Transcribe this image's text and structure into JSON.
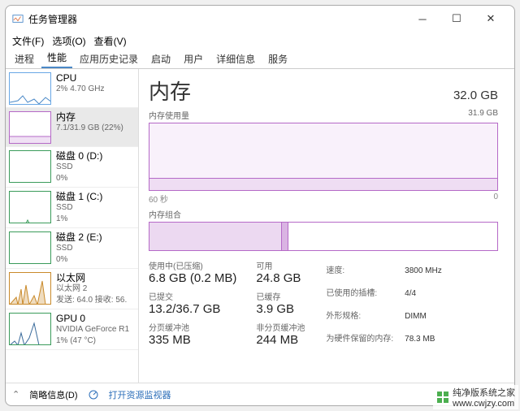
{
  "title": "任务管理器",
  "menu": {
    "file": "文件(F)",
    "options": "选项(O)",
    "view": "查看(V)"
  },
  "tabs": {
    "processes": "进程",
    "performance": "性能",
    "history": "应用历史记录",
    "startup": "启动",
    "users": "用户",
    "details": "详细信息",
    "services": "服务"
  },
  "side": {
    "cpu": {
      "title": "CPU",
      "sub": "2%  4.70 GHz"
    },
    "mem": {
      "title": "内存",
      "sub": "7.1/31.9 GB (22%)"
    },
    "disk0": {
      "title": "磁盘 0 (D:)",
      "type": "SSD",
      "pct": "0%"
    },
    "disk1": {
      "title": "磁盘 1 (C:)",
      "type": "SSD",
      "pct": "1%"
    },
    "disk2": {
      "title": "磁盘 2 (E:)",
      "type": "SSD",
      "pct": "0%"
    },
    "eth": {
      "title": "以太网",
      "name": "以太网 2",
      "sub": "发送: 64.0  接收: 56."
    },
    "gpu": {
      "title": "GPU 0",
      "name": "NVIDIA GeForce R1",
      "sub": "1% (47 °C)"
    }
  },
  "main": {
    "title": "内存",
    "total": "32.0 GB",
    "usage_label": "内存使用量",
    "usage_max": "31.9 GB",
    "axis_left": "60 秒",
    "axis_right": "0",
    "comp_label": "内存组合",
    "stats": {
      "inuse_label": "使用中(已压缩)",
      "inuse": "6.8 GB (0.2 MB)",
      "avail_label": "可用",
      "avail": "24.8 GB",
      "commit_label": "已提交",
      "commit": "13.2/36.7 GB",
      "cached_label": "已缓存",
      "cached": "3.9 GB",
      "paged_label": "分页缓冲池",
      "paged": "335 MB",
      "nonpaged_label": "非分页缓冲池",
      "nonpaged": "244 MB"
    },
    "right": {
      "speed_l": "速度:",
      "speed": "3800 MHz",
      "slots_l": "已使用的插槽:",
      "slots": "4/4",
      "form_l": "外形规格:",
      "form": "DIMM",
      "hw_l": "为硬件保留的内存:",
      "hw": "78.3 MB"
    }
  },
  "footer": {
    "fewer": "简略信息(D)",
    "resmon": "打开资源监视器"
  },
  "watermark": "纯净版系统之家\nwww.cwjzy.com"
}
